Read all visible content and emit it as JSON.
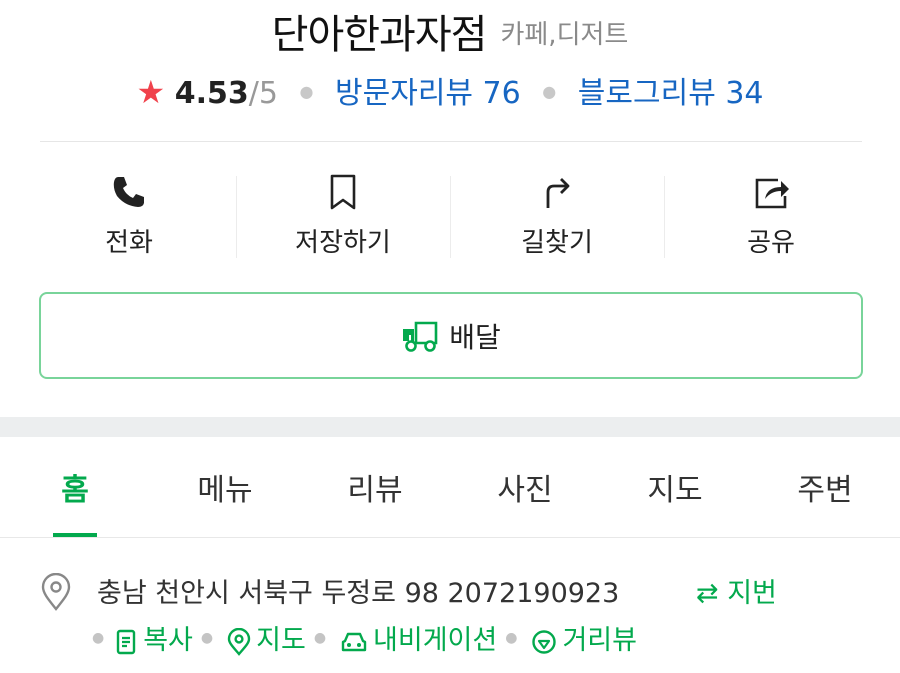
{
  "place": {
    "name": "단아한과자점",
    "category": "카페,디저트"
  },
  "rating": {
    "star_icon": "star-icon",
    "score": "4.53",
    "max": "/5",
    "visitor_reviews": "방문자리뷰 76",
    "blog_reviews": "블로그리뷰 34"
  },
  "actions": [
    {
      "label": "전화",
      "icon": "phone-icon"
    },
    {
      "label": "저장하기",
      "icon": "bookmark-icon"
    },
    {
      "label": "길찾기",
      "icon": "directions-icon"
    },
    {
      "label": "공유",
      "icon": "share-icon"
    }
  ],
  "delivery": {
    "label": "배달",
    "icon": "delivery-truck-icon"
  },
  "tabs": [
    {
      "label": "홈",
      "active": true
    },
    {
      "label": "메뉴"
    },
    {
      "label": "리뷰"
    },
    {
      "label": "사진"
    },
    {
      "label": "지도"
    },
    {
      "label": "주변"
    }
  ],
  "address": {
    "text": "충남 천안시 서북구 두정로 98 2072190923",
    "jibun": "⇄ 지번",
    "tools": {
      "copy": "복사",
      "map": "지도",
      "navigation": "내비게이션",
      "street_view": "거리뷰"
    }
  },
  "colors": {
    "brand_green": "#03a94d",
    "link_blue": "#1766c2",
    "star_red": "#f0424c",
    "delivery_border": "#79d49a"
  }
}
